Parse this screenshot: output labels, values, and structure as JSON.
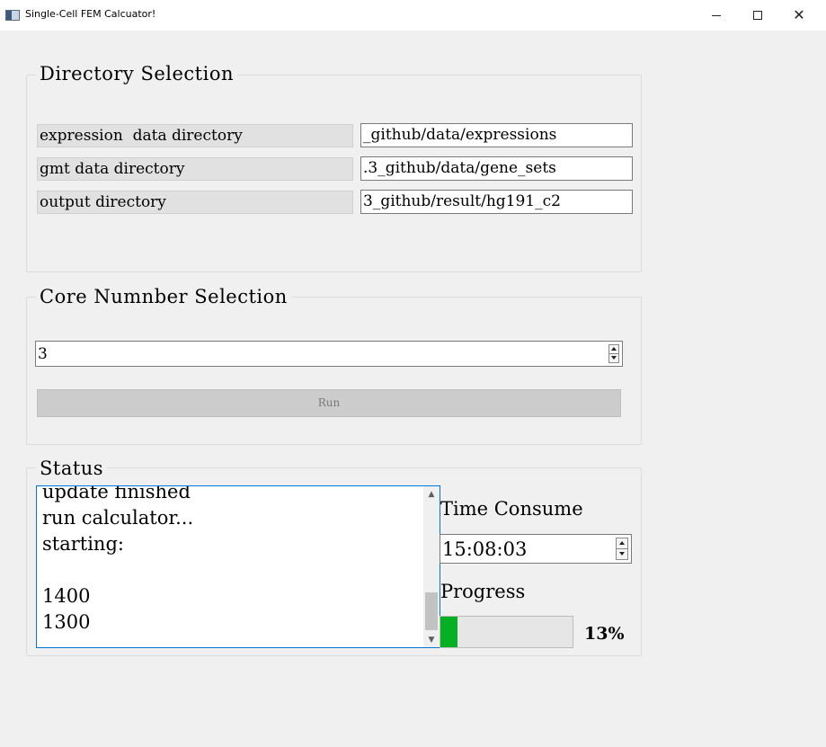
{
  "window": {
    "title": "Single-Cell FEM Calcuator!",
    "controls": {
      "minimize": "",
      "maximize": "",
      "close": "✕"
    }
  },
  "directory_selection": {
    "title": "Directory Selection",
    "rows": [
      {
        "label": "expression  data directory",
        "value": "_github/data/expressions"
      },
      {
        "label": "gmt data directory",
        "value": ".3_github/data/gene_sets"
      },
      {
        "label": "output directory",
        "value": "3_github/result/hg191_c2"
      }
    ]
  },
  "core_selection": {
    "title": "Core Numnber Selection",
    "value": "3",
    "run_label": "Run"
  },
  "status": {
    "title": "Status",
    "log_lines": [
      "update finished",
      "run calculator...",
      "starting:",
      "",
      "1400",
      "1300"
    ],
    "time_label": "Time Consume",
    "time_value": "15:08:03",
    "progress_label": "Progress",
    "progress_fraction": 0.13,
    "progress_text": "13%"
  },
  "colors": {
    "progress_fill": "#06b025",
    "log_focus_border": "#0078d7",
    "run_disabled": "#cccccc"
  },
  "icons": [
    "app-icon",
    "minimize-icon",
    "maximize-icon",
    "close-icon",
    "chevron-up-icon",
    "chevron-down-icon"
  ]
}
